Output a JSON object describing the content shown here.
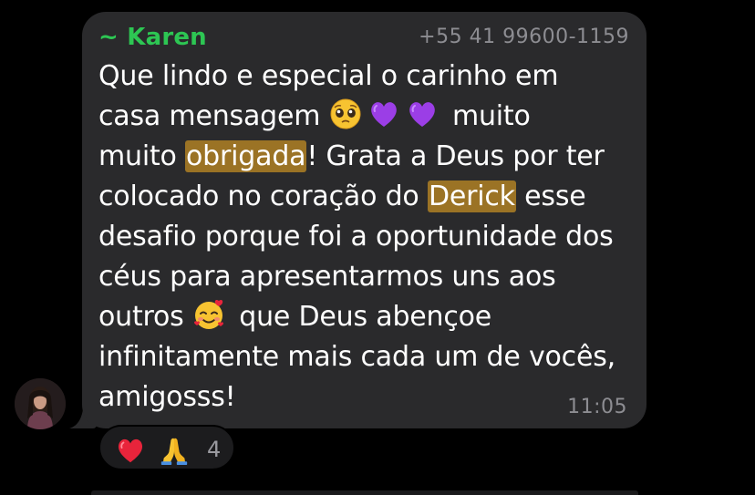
{
  "message": {
    "sender_name": "~ Karen",
    "sender_phone": "+55 41 99600-1159",
    "time": "11:05",
    "lines": [
      [
        "Que lindo e especial o carinho em"
      ],
      [
        "casa mensagem ",
        " muito"
      ],
      [
        "muito ",
        "obrigada",
        "! Grata a Deus por ter"
      ],
      [
        "colocado no coração do ",
        "Derick",
        " esse"
      ],
      [
        "desafio porque foi a oportunidade dos"
      ],
      [
        "céus para apresentarmos uns aos"
      ],
      [
        "outros ",
        " que Deus abençoe"
      ],
      [
        "infinitamente mais cada um de vocês,"
      ],
      [
        "amigosss!"
      ]
    ],
    "emojis": [
      "pleading-face-emoji",
      "purple-heart-emoji",
      "purple-heart-emoji",
      "smiling-face-with-hearts-emoji"
    ],
    "highlighted_words": [
      "obrigada",
      "Derick"
    ]
  },
  "reactions": {
    "emojis": [
      "red-heart-emoji",
      "folded-hands-emoji"
    ],
    "count": "4"
  },
  "colors": {
    "background": "#000000",
    "bubble": "#2a2a2c",
    "sender_name": "#2dc653",
    "meta_text": "#8d8d92",
    "highlight": "#9b7325"
  }
}
